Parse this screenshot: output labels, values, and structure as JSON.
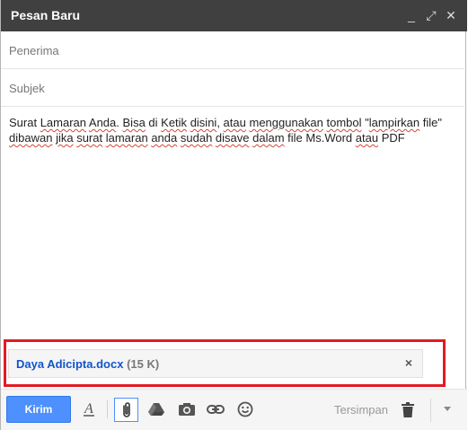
{
  "window": {
    "title": "Pesan Baru",
    "minimize_label": "_",
    "popout_label": "⤢",
    "close_label": "✕"
  },
  "fields": {
    "to_placeholder": "Penerima",
    "subject_placeholder": "Subjek"
  },
  "message": {
    "line1": [
      {
        "text": "Surat ",
        "spell": false
      },
      {
        "text": "Lamaran",
        "spell": true
      },
      {
        "text": " ",
        "spell": false
      },
      {
        "text": "Anda",
        "spell": true
      },
      {
        "text": ". ",
        "spell": false
      },
      {
        "text": "Bisa",
        "spell": true
      },
      {
        "text": " di ",
        "spell": false
      },
      {
        "text": "Ketik",
        "spell": true
      },
      {
        "text": " ",
        "spell": false
      },
      {
        "text": "disini",
        "spell": true
      },
      {
        "text": ", ",
        "spell": false
      },
      {
        "text": "atau",
        "spell": true
      },
      {
        "text": " ",
        "spell": false
      },
      {
        "text": "menggunakan",
        "spell": true
      },
      {
        "text": " ",
        "spell": false
      },
      {
        "text": "tombol",
        "spell": true
      },
      {
        "text": " \"",
        "spell": false
      },
      {
        "text": "lampirkan",
        "spell": true
      },
      {
        "text": " file\"",
        "spell": false
      }
    ],
    "line2": [
      {
        "text": "dibawan",
        "spell": true
      },
      {
        "text": " ",
        "spell": false
      },
      {
        "text": "jika",
        "spell": true
      },
      {
        "text": " ",
        "spell": false
      },
      {
        "text": "surat",
        "spell": true
      },
      {
        "text": " ",
        "spell": false
      },
      {
        "text": "lamaran",
        "spell": true
      },
      {
        "text": " ",
        "spell": false
      },
      {
        "text": "anda",
        "spell": true
      },
      {
        "text": " ",
        "spell": false
      },
      {
        "text": "sudah",
        "spell": true
      },
      {
        "text": " ",
        "spell": false
      },
      {
        "text": "disave",
        "spell": true
      },
      {
        "text": " ",
        "spell": false
      },
      {
        "text": "dalam",
        "spell": true
      },
      {
        "text": " file Ms.Word ",
        "spell": false
      },
      {
        "text": "atau",
        "spell": true
      },
      {
        "text": " PDF",
        "spell": false
      }
    ]
  },
  "attachment": {
    "filename": "Daya Adicipta.docx",
    "size": "(15 K)",
    "remove_label": "×"
  },
  "toolbar": {
    "send_label": "Kirim",
    "saved_label": "Tersimpan",
    "icons": [
      "format-text-icon",
      "attach-file-icon",
      "drive-icon",
      "insert-photo-icon",
      "insert-link-icon",
      "emoji-icon",
      "trash-icon",
      "more-options-icon"
    ]
  },
  "colors": {
    "titlebar_bg": "#404040",
    "send_button": "#4d90fe",
    "attachment_link": "#1155cc",
    "highlight_box": "#e21a23"
  }
}
